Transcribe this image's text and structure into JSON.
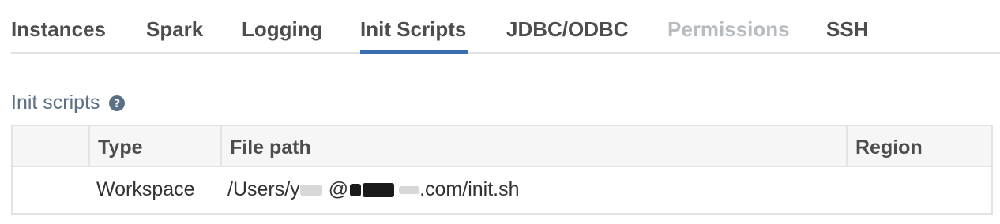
{
  "tabs": [
    {
      "label": "Instances",
      "state": "normal"
    },
    {
      "label": "Spark",
      "state": "normal"
    },
    {
      "label": "Logging",
      "state": "normal"
    },
    {
      "label": "Init Scripts",
      "state": "active"
    },
    {
      "label": "JDBC/ODBC",
      "state": "normal"
    },
    {
      "label": "Permissions",
      "state": "disabled"
    },
    {
      "label": "SSH",
      "state": "normal"
    }
  ],
  "section": {
    "title": "Init scripts",
    "help_icon": "question-circle-icon"
  },
  "table": {
    "headers": [
      "",
      "Type",
      "File path",
      "Region"
    ],
    "rows": [
      {
        "select": "",
        "type": "Workspace",
        "path_prefix": "/Users/y",
        "path_mid": "@",
        "path_suffix": ".com/init.sh",
        "region": ""
      }
    ]
  },
  "colors": {
    "accent": "#3b6eb0",
    "section_title": "#5b6f85",
    "disabled_tab": "#b6bcc0",
    "border": "#e3e3e3"
  }
}
